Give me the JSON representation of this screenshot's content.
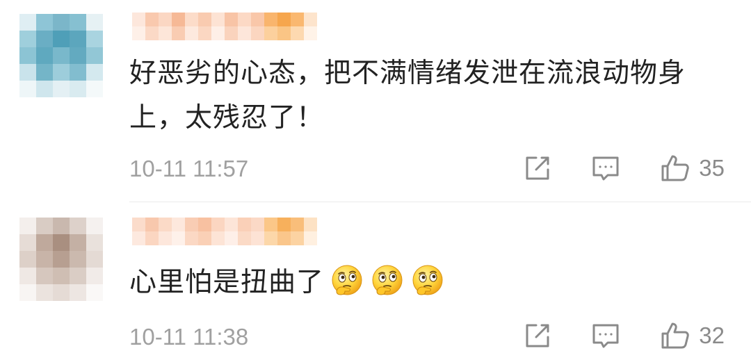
{
  "comments": [
    {
      "text": "好恶劣的心态，把不满情绪发泄在流浪动物身上，太残忍了！",
      "time": "10-11 11:57",
      "likes": "35",
      "emojis": []
    },
    {
      "text": "心里怕是扭曲了",
      "time": "10-11 11:38",
      "likes": "32",
      "emojis": [
        "thinking-face-icon",
        "thinking-face-icon",
        "thinking-face-icon"
      ]
    }
  ],
  "icons": {
    "share": "share-icon",
    "reply": "comment-icon",
    "like": "thumbs-up-icon"
  },
  "colors": {
    "text": "#222222",
    "meta": "#a0a0a0",
    "icon": "#8a8a8a"
  }
}
